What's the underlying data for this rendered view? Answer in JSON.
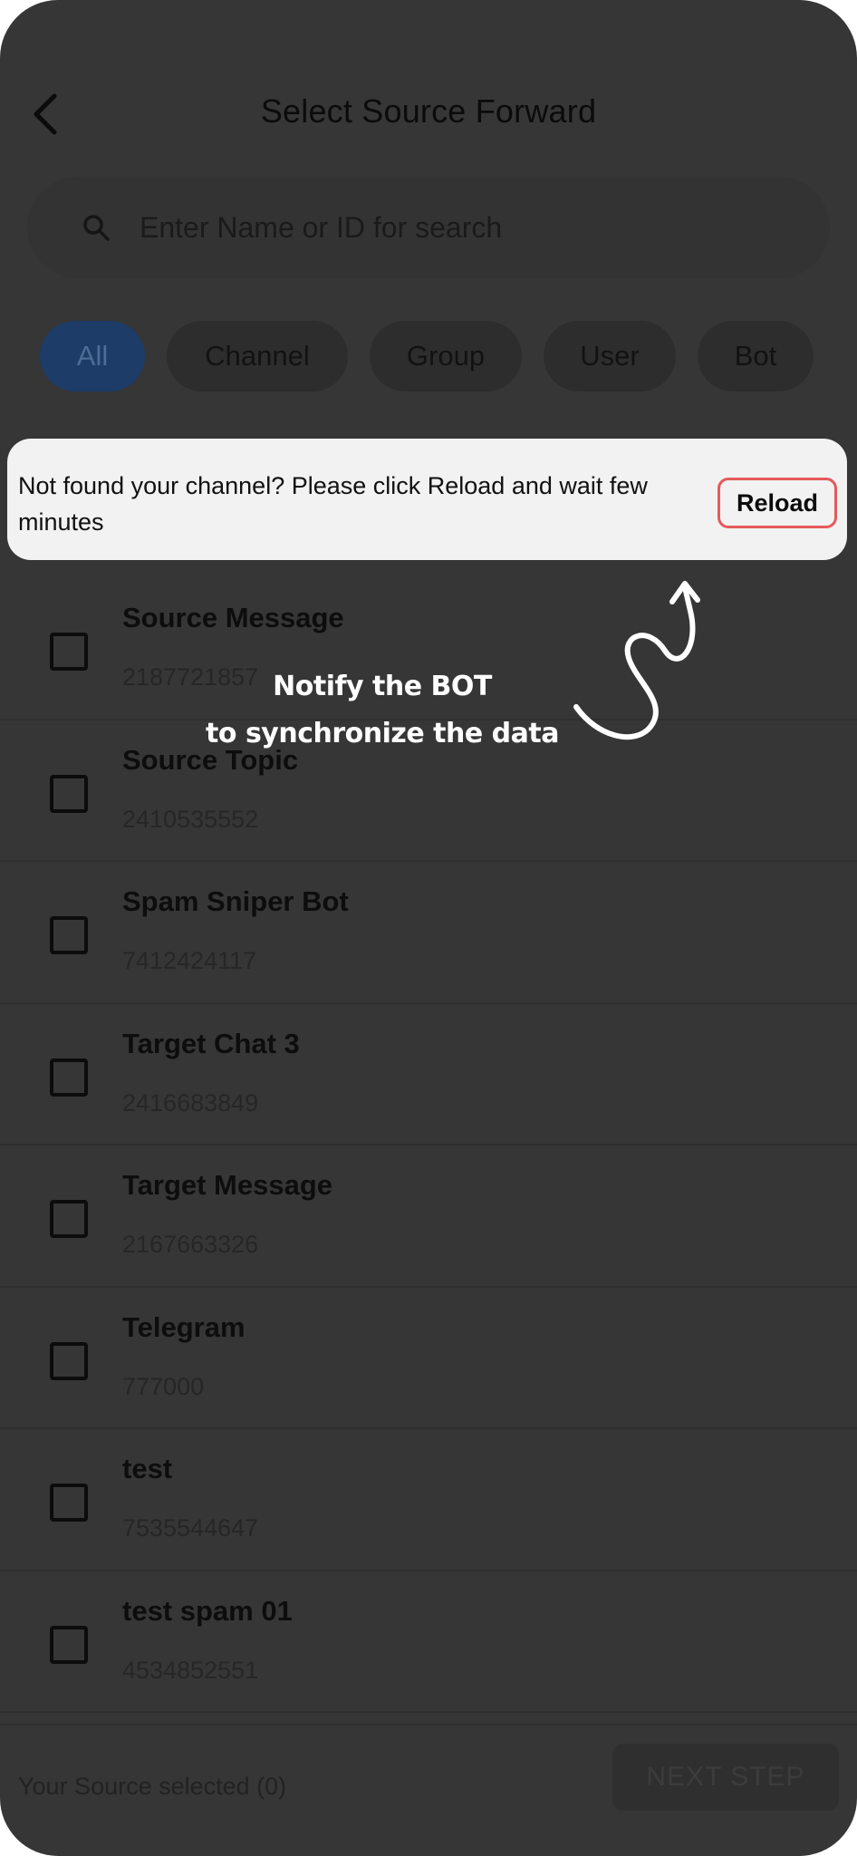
{
  "header": {
    "back_icon": "chevron-left-icon",
    "title": "Select Source Forward"
  },
  "search": {
    "icon": "search-icon",
    "placeholder": "Enter Name or ID for search",
    "value": ""
  },
  "filters": {
    "selected": "All",
    "chips": [
      {
        "label": "All"
      },
      {
        "label": "Channel"
      },
      {
        "label": "Group"
      },
      {
        "label": "User"
      },
      {
        "label": "Bot"
      }
    ]
  },
  "banner": {
    "message": "Not found your channel? Please click Reload and wait few minutes",
    "reload_label": "Reload"
  },
  "annotation": {
    "line1": "Notify the BOT",
    "line2": "to synchronize the data"
  },
  "sources": [
    {
      "name": "Source Message",
      "id": "2187721857",
      "checked": false
    },
    {
      "name": "Source Topic",
      "id": "2410535552",
      "checked": false
    },
    {
      "name": "Spam Sniper Bot",
      "id": "7412424117",
      "checked": false
    },
    {
      "name": "Target Chat 3",
      "id": "2416683849",
      "checked": false
    },
    {
      "name": "Target Message",
      "id": "2167663326",
      "checked": false
    },
    {
      "name": "Telegram",
      "id": "777000",
      "checked": false
    },
    {
      "name": "test",
      "id": "7535544647",
      "checked": false
    },
    {
      "name": "test spam 01",
      "id": "4534852551",
      "checked": false
    }
  ],
  "footer": {
    "selected_text": "Your Source selected (0)",
    "next_label": "NEXT STEP"
  },
  "colors": {
    "overlay": "#363636",
    "banner_bg": "#f2f2f2",
    "reload_border": "#e55a5a",
    "active_chip": "#1d3c67"
  }
}
